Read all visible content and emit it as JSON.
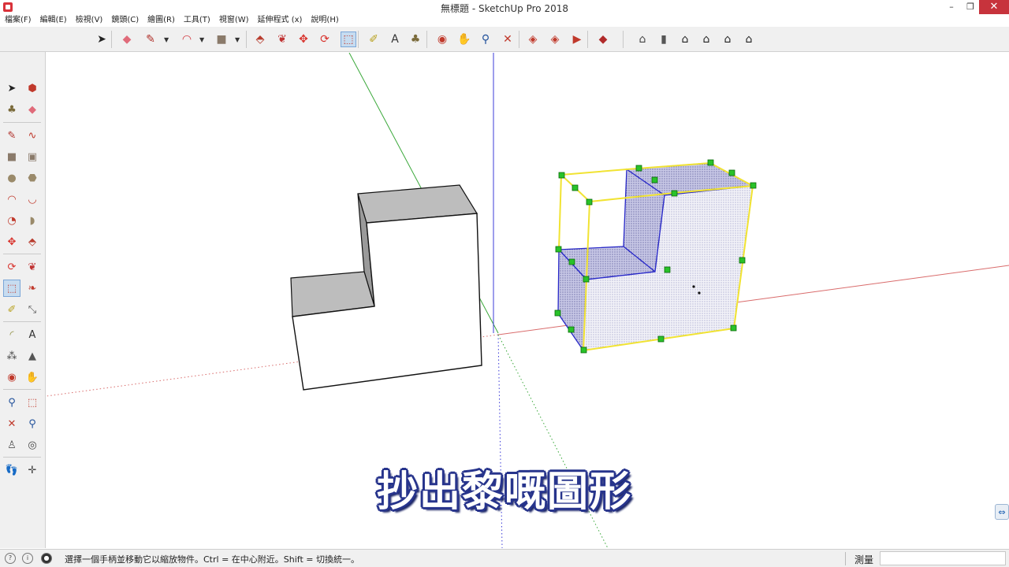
{
  "window": {
    "title": "無標題 - SketchUp Pro 2018",
    "minimize_glyph": "–",
    "restore_glyph": "❐",
    "close_glyph": "✕"
  },
  "menubar": [
    {
      "label": "檔案(F)"
    },
    {
      "label": "編輯(E)"
    },
    {
      "label": "檢視(V)"
    },
    {
      "label": "鏡頭(C)"
    },
    {
      "label": "繪圖(R)"
    },
    {
      "label": "工具(T)"
    },
    {
      "label": "視窗(W)"
    },
    {
      "label": "延伸程式 (x)"
    },
    {
      "label": "說明(H)"
    }
  ],
  "toolbar_top": {
    "icons": [
      {
        "name": "select-icon",
        "glyph": "➤",
        "color": "#222222"
      },
      {
        "name": "eraser-icon",
        "glyph": "◆",
        "color": "#e06b7a"
      },
      {
        "name": "line-icon",
        "glyph": "✎",
        "color": "#b0302a"
      },
      {
        "name": "arc-icon",
        "glyph": "◠",
        "color": "#d2353c"
      },
      {
        "name": "rectangle-icon",
        "glyph": "■",
        "color": "#8a7a6a"
      },
      {
        "name": "push-pull-icon",
        "glyph": "⬘",
        "color": "#b83c2e"
      },
      {
        "name": "follow-me-icon",
        "glyph": "❦",
        "color": "#c03333"
      },
      {
        "name": "move-icon",
        "glyph": "✥",
        "color": "#d8332d"
      },
      {
        "name": "rotate-icon",
        "glyph": "⟳",
        "color": "#d8332d"
      },
      {
        "name": "scale-icon",
        "glyph": "⬚",
        "color": "#c0392b"
      },
      {
        "name": "tape-measure-icon",
        "glyph": "✐",
        "color": "#b8a11e"
      },
      {
        "name": "text-icon",
        "glyph": "A",
        "color": "#333333"
      },
      {
        "name": "paint-bucket-icon",
        "glyph": "♣",
        "color": "#7a6a3a"
      },
      {
        "name": "orbit-icon",
        "glyph": "◉",
        "color": "#c0392b"
      },
      {
        "name": "pan-icon",
        "glyph": "✋",
        "color": "#d4a23a"
      },
      {
        "name": "zoom-icon",
        "glyph": "⚲",
        "color": "#1f4f9a"
      },
      {
        "name": "zoom-extents-icon",
        "glyph": "✕",
        "color": "#c0392b"
      },
      {
        "name": "warehouse-icon",
        "glyph": "◈",
        "color": "#c0392b"
      },
      {
        "name": "extension-warehouse-icon",
        "glyph": "◈",
        "color": "#c0392b"
      },
      {
        "name": "send-to-layout-icon",
        "glyph": "▶",
        "color": "#c0392b"
      },
      {
        "name": "extension-manager-icon",
        "glyph": "◆",
        "color": "#b02a2a"
      },
      {
        "name": "iso-view-icon",
        "glyph": "⌂",
        "color": "#444444"
      },
      {
        "name": "top-view-icon",
        "glyph": "▮",
        "color": "#555555"
      },
      {
        "name": "front-view-icon",
        "glyph": "⌂",
        "color": "#222222"
      },
      {
        "name": "right-view-icon",
        "glyph": "⌂",
        "color": "#222222"
      },
      {
        "name": "back-view-icon",
        "glyph": "⌂",
        "color": "#222222"
      },
      {
        "name": "left-view-icon",
        "glyph": "⌂",
        "color": "#222222"
      }
    ]
  },
  "toolbar_left": {
    "icons": [
      {
        "name": "select-icon",
        "glyph": "➤",
        "color": "#222222"
      },
      {
        "name": "make-component-icon",
        "glyph": "⬢",
        "color": "#c0392b"
      },
      {
        "name": "paint-bucket-icon",
        "glyph": "♣",
        "color": "#7a6a3a"
      },
      {
        "name": "eraser-icon",
        "glyph": "◆",
        "color": "#e06b7a"
      },
      {
        "name": "line-icon",
        "glyph": "✎",
        "color": "#b0302a"
      },
      {
        "name": "freehand-icon",
        "glyph": "∿",
        "color": "#c0392b"
      },
      {
        "name": "rectangle-icon",
        "glyph": "■",
        "color": "#8a7a6a"
      },
      {
        "name": "rotated-rectangle-icon",
        "glyph": "▣",
        "color": "#8a7a6a"
      },
      {
        "name": "circle-icon",
        "glyph": "●",
        "color": "#9a8a6a"
      },
      {
        "name": "polygon-icon",
        "glyph": "⬣",
        "color": "#9a8a6a"
      },
      {
        "name": "arc-icon",
        "glyph": "◠",
        "color": "#c0392b"
      },
      {
        "name": "two-point-arc-icon",
        "glyph": "◡",
        "color": "#c0392b"
      },
      {
        "name": "three-point-arc-icon",
        "glyph": "◔",
        "color": "#c0392b"
      },
      {
        "name": "pie-icon",
        "glyph": "◗",
        "color": "#9a8a6a"
      },
      {
        "name": "move-icon",
        "glyph": "✥",
        "color": "#d8332d"
      },
      {
        "name": "push-pull-icon",
        "glyph": "⬘",
        "color": "#b83c2e"
      },
      {
        "name": "rotate-icon",
        "glyph": "⟳",
        "color": "#d8332d"
      },
      {
        "name": "follow-me-icon",
        "glyph": "❦",
        "color": "#c03333"
      },
      {
        "name": "scale-icon",
        "glyph": "⬚",
        "color": "#c0392b"
      },
      {
        "name": "offset-icon",
        "glyph": "❧",
        "color": "#c0392b"
      },
      {
        "name": "tape-measure-icon",
        "glyph": "✐",
        "color": "#b8a11e"
      },
      {
        "name": "dimension-icon",
        "glyph": "⤡",
        "color": "#555555"
      },
      {
        "name": "protractor-icon",
        "glyph": "◜",
        "color": "#8a8a3a"
      },
      {
        "name": "text-icon",
        "glyph": "A",
        "color": "#333333"
      },
      {
        "name": "axes-icon",
        "glyph": "⁂",
        "color": "#444444"
      },
      {
        "name": "3d-text-icon",
        "glyph": "▲",
        "color": "#555555"
      },
      {
        "name": "orbit-icon",
        "glyph": "◉",
        "color": "#c0392b"
      },
      {
        "name": "pan-icon",
        "glyph": "✋",
        "color": "#d4a23a"
      },
      {
        "name": "zoom-icon",
        "glyph": "⚲",
        "color": "#1f4f9a"
      },
      {
        "name": "zoom-window-icon",
        "glyph": "⬚",
        "color": "#c0392b"
      },
      {
        "name": "zoom-extents-icon",
        "glyph": "✕",
        "color": "#c0392b"
      },
      {
        "name": "previous-view-icon",
        "glyph": "⚲",
        "color": "#1f4f9a"
      },
      {
        "name": "position-camera-icon",
        "glyph": "♙",
        "color": "#555555"
      },
      {
        "name": "look-around-icon",
        "glyph": "◎",
        "color": "#444444"
      },
      {
        "name": "walk-icon",
        "glyph": "👣",
        "color": "#333333"
      },
      {
        "name": "section-plane-icon",
        "glyph": "✛",
        "color": "#444444"
      }
    ]
  },
  "subtitle": "抄出黎嘅圖形",
  "side_widget_glyph": "⇔",
  "statusbar": {
    "hint": "選擇一個手柄並移動它以縮放物件。Ctrl = 在中心附近。Shift = 切換統一。",
    "measure_label": "測量",
    "measure_value": ""
  },
  "colors": {
    "axis_red": "#d96b6b",
    "axis_green": "#3aa83a",
    "axis_blue": "#3b3bd8",
    "selection_yellow": "#f1e332",
    "selection_blue": "#2a2ac8",
    "grip_green": "#29c229",
    "face_top": "#bdbdbd",
    "face_selected": "#c8c8e6"
  }
}
